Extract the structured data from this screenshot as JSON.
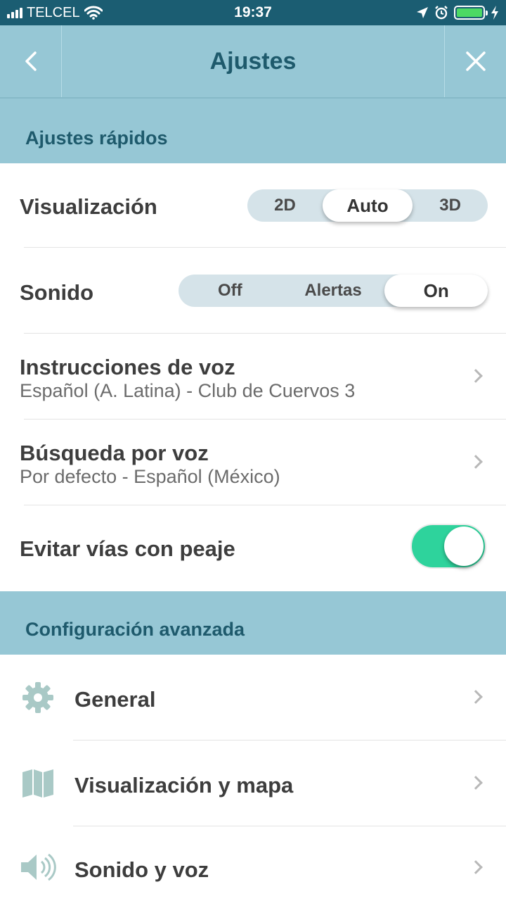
{
  "status_bar": {
    "carrier": "TELCEL",
    "time": "19:37",
    "battery_color": "#4cd964"
  },
  "nav": {
    "title": "Ajustes",
    "back_icon": "chevron-left-icon",
    "close_icon": "close-icon"
  },
  "quick": {
    "header": "Ajustes rápidos",
    "visualizacion": {
      "label": "Visualización",
      "options": [
        "2D",
        "Auto",
        "3D"
      ],
      "selected": "Auto"
    },
    "sonido": {
      "label": "Sonido",
      "options": [
        "Off",
        "Alertas",
        "On"
      ],
      "selected": "On"
    },
    "voz": {
      "label": "Instrucciones de voz",
      "value": "Español (A. Latina) - Club de Cuervos 3"
    },
    "busqueda": {
      "label": "Búsqueda por voz",
      "value": "Por defecto - Español (México)"
    },
    "peaje": {
      "label": "Evitar vías con peaje",
      "enabled": true
    }
  },
  "advanced": {
    "header": "Configuración avanzada",
    "items": [
      {
        "label": "General",
        "icon": "gear-icon"
      },
      {
        "label": "Visualización y mapa",
        "icon": "map-icon"
      },
      {
        "label": "Sonido y voz",
        "icon": "speaker-icon"
      }
    ]
  },
  "colors": {
    "nav_bg": "#96c7d5",
    "status_bg": "#1b5d72",
    "title_text": "#1e5a6c",
    "toggle_on": "#2ed39c",
    "segment_bg": "#d5e3e9"
  }
}
